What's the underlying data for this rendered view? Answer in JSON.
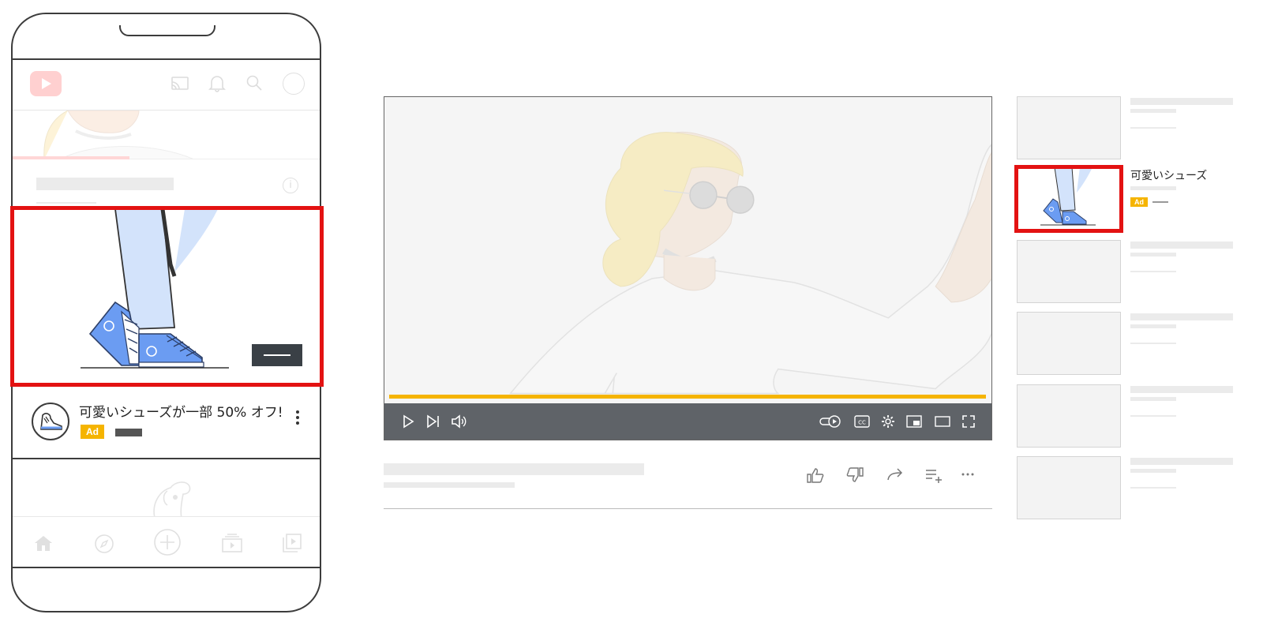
{
  "mobile": {
    "ad": {
      "headline": "可愛いシューズが一部 50% オフ!",
      "badge": "Ad"
    }
  },
  "desktop": {
    "sidebar": {
      "ad": {
        "title": "可愛いシューズ",
        "badge": "Ad"
      }
    },
    "player": {
      "progress_fraction": 1.0
    }
  },
  "colors": {
    "highlight": "#e31212",
    "ad_badge": "#f5b400",
    "progress": "#f5b400",
    "controls_bg": "#5f6368"
  }
}
